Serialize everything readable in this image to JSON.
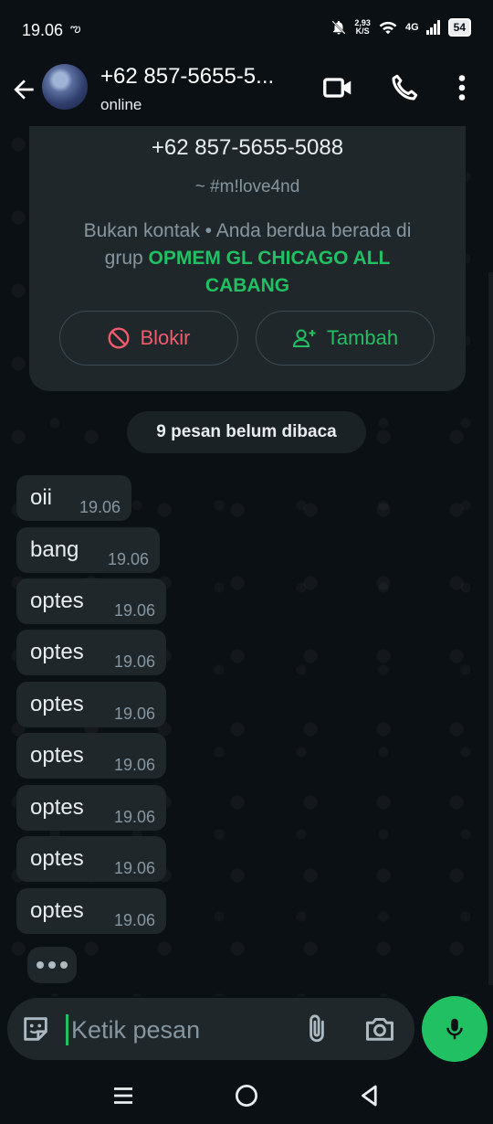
{
  "status_bar": {
    "time": "19.06",
    "speed_value": "2,93",
    "speed_unit": "K/S",
    "network": "4G",
    "battery": "54"
  },
  "header": {
    "contact_name": "+62 857-5655-5...",
    "status": "online"
  },
  "info_card": {
    "phone": "+62 857-5655-5088",
    "alias": "~ #m!love4nd",
    "desc_prefix": "Bukan kontak • Anda berdua berada di grup ",
    "group_name": "OPMEM GL CHICAGO ALL CABANG",
    "block_label": "Blokir",
    "add_label": "Tambah",
    "block_color": "#f15c6d",
    "accent_color": "#21c063"
  },
  "unread_label": "9 pesan belum dibaca",
  "messages": [
    {
      "text": "oii",
      "time": "19.06"
    },
    {
      "text": "bang",
      "time": "19.06"
    },
    {
      "text": "optes",
      "time": "19.06"
    },
    {
      "text": "optes",
      "time": "19.06"
    },
    {
      "text": "optes",
      "time": "19.06"
    },
    {
      "text": "optes",
      "time": "19.06"
    },
    {
      "text": "optes",
      "time": "19.06"
    },
    {
      "text": "optes",
      "time": "19.06"
    },
    {
      "text": "optes",
      "time": "19.06"
    }
  ],
  "input": {
    "placeholder": "Ketik pesan"
  },
  "icons": {
    "back": "arrow-left-icon",
    "video": "video-camera-icon",
    "call": "phone-icon",
    "menu": "more-vertical-icon",
    "emoji": "sticker-icon",
    "attach": "paperclip-icon",
    "camera": "camera-icon",
    "mic": "microphone-icon"
  }
}
